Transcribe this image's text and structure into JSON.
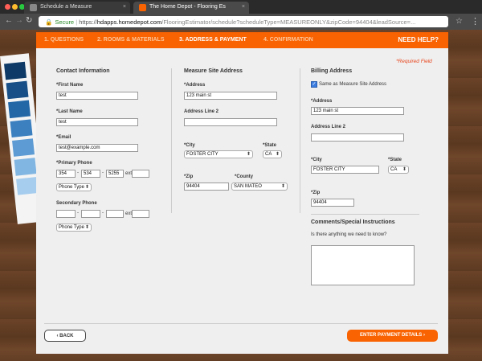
{
  "browser": {
    "tabs": [
      {
        "title": "Schedule a Measure",
        "close": "×"
      },
      {
        "title": "The Home Depot - Flooring Es",
        "close": "×"
      }
    ],
    "nav": {
      "back": "←",
      "forward": "→",
      "reload": "↻"
    },
    "url": {
      "lock": "🔒",
      "secure": "Secure",
      "sep": " | ",
      "scheme": "https://",
      "host": "hdapps.homedepot.com",
      "path": "/FlooringEstimator/schedule?scheduleType=MEASUREONLY&zipCode=94404&leadSource=..."
    },
    "star": "☆",
    "menu": "⋮"
  },
  "progress": {
    "steps": [
      "1. QUESTIONS",
      "2. ROOMS & MATERIALS",
      "3. ADDRESS & PAYMENT",
      "4. CONFIRMATION"
    ],
    "need_help": "NEED HELP?"
  },
  "required_note": "*Required Field",
  "contact": {
    "heading": "Contact Information",
    "first_name_label": "*First Name",
    "first_name": "test",
    "last_name_label": "*Last Name",
    "last_name": "test",
    "email_label": "*Email",
    "email": "test@example.com",
    "primary_label": "*Primary Phone",
    "primary": {
      "p1": "354",
      "p2": "534",
      "p3": "5255",
      "ext_label": "ext.",
      "ext": ""
    },
    "dash": "-",
    "primary_type": "Phone Type",
    "secondary_label": "Secondary Phone",
    "secondary": {
      "p1": "",
      "p2": "",
      "p3": "",
      "ext_label": "ext.",
      "ext": ""
    },
    "secondary_type": "Phone Type",
    "arrow": "⬍"
  },
  "measure": {
    "heading": "Measure Site Address",
    "address_label": "*Address",
    "address": "123 main st",
    "address2_label": "Address Line 2",
    "address2": "",
    "city_label": "*City",
    "city": "FOSTER CITY",
    "state_label": "*State",
    "state": "CA",
    "zip_label": "*Zip",
    "zip": "94404",
    "county_label": "*County",
    "county": "SAN MATEO"
  },
  "billing": {
    "heading": "Billing Address",
    "same_check": "✓",
    "same_label": "Same as Measure Site Address",
    "address_label": "*Address",
    "address": "123 main st",
    "address2_label": "Address Line 2",
    "address2": "",
    "city_label": "*City",
    "city": "FOSTER CITY",
    "state_label": "*State",
    "state": "CA",
    "zip_label": "*Zip",
    "zip": "94404",
    "comments_heading": "Comments/Special Instructions",
    "comments_question": "Is there anything we need to know?"
  },
  "buttons": {
    "back": "‹  BACK",
    "enter": "ENTER PAYMENT DETAILS  ›"
  },
  "colors": {
    "accent": "#f96302",
    "required": "#e8461e"
  }
}
